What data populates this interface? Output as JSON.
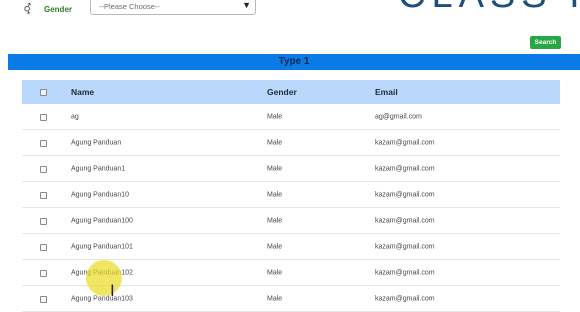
{
  "filter": {
    "gender_icon": "gender-icon",
    "gender_label": "Gender",
    "gender_select_value": "--Please Choose--",
    "select_arrow": "▼"
  },
  "brand": {
    "logo_text": "CLASS I"
  },
  "search_button": "Search",
  "type_title": "Type 1",
  "table": {
    "columns": {
      "name": "Name",
      "gender": "Gender",
      "email": "Email"
    },
    "rows": [
      {
        "name": "ag",
        "gender": "Male",
        "email": "ag@gmail.com"
      },
      {
        "name": "Agung Panduan",
        "gender": "Male",
        "email": "kazam@gmail.com"
      },
      {
        "name": "Agung Panduan1",
        "gender": "Male",
        "email": "kazam@gmail.com"
      },
      {
        "name": "Agung Panduan10",
        "gender": "Male",
        "email": "kazam@gmail.com"
      },
      {
        "name": "Agung Panduan100",
        "gender": "Male",
        "email": "kazam@gmail.com"
      },
      {
        "name": "Agung Panduan101",
        "gender": "Male",
        "email": "kazam@gmail.com"
      },
      {
        "name": "Agung Panduan102",
        "gender": "Male",
        "email": "kazam@gmail.com"
      },
      {
        "name": "Agung Panduan103",
        "gender": "Male",
        "email": "kazam@gmail.com"
      }
    ]
  },
  "colors": {
    "type_bar": "#0a7ae6",
    "header_row": "#b9d8fb",
    "search_button": "#28a745",
    "gender_label": "#2e7d32",
    "cursor_highlight": "#ecdc28"
  }
}
